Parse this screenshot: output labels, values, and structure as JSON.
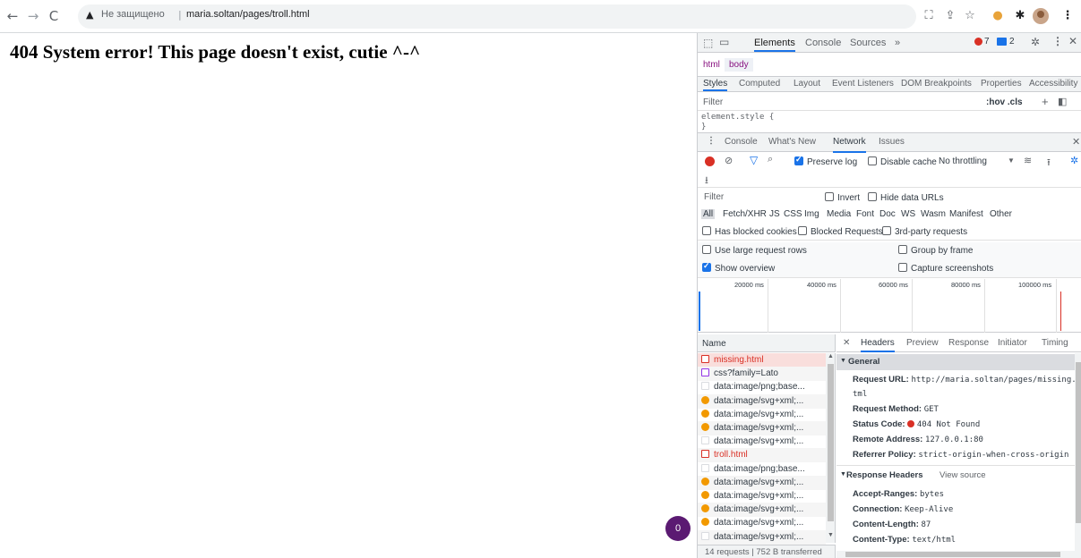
{
  "browser": {
    "insecure_label": "Не защищено",
    "separator": "|",
    "url": "maria.soltan/pages/troll.html"
  },
  "page": {
    "heading": "404 System error! This page doesn't exist, cutie ^-^",
    "badge_count": "0"
  },
  "devtools": {
    "top_tabs": [
      "Elements",
      "Console",
      "Sources",
      "»"
    ],
    "error_count": "7",
    "message_count": "2",
    "breadcrumb": [
      "html",
      "body"
    ],
    "styles_tabs": [
      "Styles",
      "Computed",
      "Layout",
      "Event Listeners",
      "DOM Breakpoints",
      "Properties",
      "Accessibility"
    ],
    "styles_filter_placeholder": "Filter",
    "hov_cls": ":hov  .cls",
    "element_style": "element.style {",
    "element_style_close": "}",
    "drawer_tabs": [
      "Console",
      "What's New",
      "Network",
      "Issues"
    ],
    "preserve_log": "Preserve log",
    "disable_cache": "Disable cache",
    "throttling": "No throttling",
    "filter_placeholder": "Filter",
    "invert": "Invert",
    "hide_data_urls": "Hide data URLs",
    "type_filters": [
      "All",
      "Fetch/XHR",
      "JS",
      "CSS",
      "Img",
      "Media",
      "Font",
      "Doc",
      "WS",
      "Wasm",
      "Manifest",
      "Other"
    ],
    "has_blocked_cookies": "Has blocked cookies",
    "blocked_requests": "Blocked Requests",
    "third_party": "3rd-party requests",
    "large_rows": "Use large request rows",
    "group_by_frame": "Group by frame",
    "show_overview": "Show overview",
    "capture_screenshots": "Capture screenshots",
    "timeline_ticks": [
      "20000 ms",
      "40000 ms",
      "60000 ms",
      "80000 ms",
      "100000 ms"
    ],
    "name_header": "Name",
    "requests": [
      {
        "name": "missing.html",
        "kind": "doc-error"
      },
      {
        "name": "css?family=Lato",
        "kind": "css"
      },
      {
        "name": "data:image/png;base...",
        "kind": "blank"
      },
      {
        "name": "data:image/svg+xml;...",
        "kind": "img"
      },
      {
        "name": "data:image/svg+xml;...",
        "kind": "img"
      },
      {
        "name": "data:image/svg+xml;...",
        "kind": "img"
      },
      {
        "name": "data:image/svg+xml;...",
        "kind": "blank"
      },
      {
        "name": "troll.html",
        "kind": "doc-error"
      },
      {
        "name": "data:image/png;base...",
        "kind": "blank"
      },
      {
        "name": "data:image/svg+xml;...",
        "kind": "img"
      },
      {
        "name": "data:image/svg+xml;...",
        "kind": "img"
      },
      {
        "name": "data:image/svg+xml;...",
        "kind": "img"
      },
      {
        "name": "data:image/svg+xml;...",
        "kind": "img"
      },
      {
        "name": "data:image/svg+xml;...",
        "kind": "blank"
      }
    ],
    "status_bar": "14 requests  |  752 B transferred",
    "detail_tabs": [
      "Headers",
      "Preview",
      "Response",
      "Initiator",
      "Timing"
    ],
    "general_title": "General",
    "request_url_label": "Request URL:",
    "request_url_value": "http://maria.soltan/pages/missing.h",
    "request_url_value_2": "tml",
    "request_method_label": "Request Method:",
    "request_method_value": "GET",
    "status_code_label": "Status Code:",
    "status_code_value": "404 Not Found",
    "remote_address_label": "Remote Address:",
    "remote_address_value": "127.0.0.1:80",
    "referrer_policy_label": "Referrer Policy:",
    "referrer_policy_value": "strict-origin-when-cross-origin",
    "response_headers_title": "Response Headers",
    "view_source": "View source",
    "response_headers": [
      {
        "label": "Accept-Ranges:",
        "value": "bytes"
      },
      {
        "label": "Connection:",
        "value": "Keep-Alive"
      },
      {
        "label": "Content-Length:",
        "value": "87"
      },
      {
        "label": "Content-Type:",
        "value": "text/html"
      }
    ]
  },
  "colors": {
    "accent": "#1a73e8",
    "error_red": "#d93025",
    "selected_row": "#f9dedc",
    "badge": "#5b1a72"
  }
}
